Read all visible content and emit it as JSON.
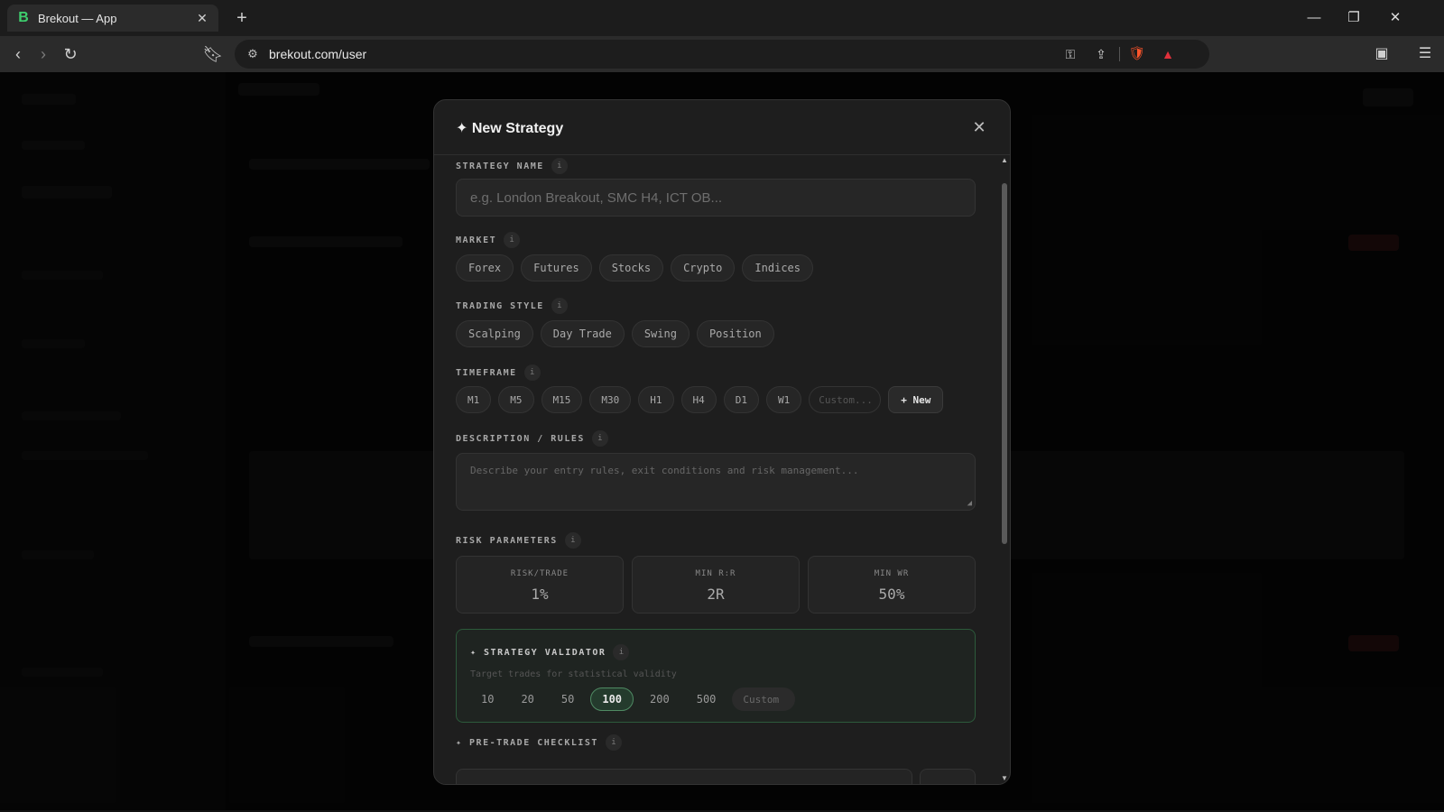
{
  "browser": {
    "tab_title": "Brekout — App",
    "tab_favicon": "B",
    "url": "brekout.com/user"
  },
  "modal": {
    "title": "✦ New Strategy",
    "strategy_name": {
      "label": "STRATEGY NAME",
      "placeholder": "e.g. London Breakout, SMC H4, ICT OB..."
    },
    "market": {
      "label": "MARKET",
      "options": [
        "Forex",
        "Futures",
        "Stocks",
        "Crypto",
        "Indices"
      ]
    },
    "trading_style": {
      "label": "TRADING STYLE",
      "options": [
        "Scalping",
        "Day Trade",
        "Swing",
        "Position"
      ]
    },
    "timeframe": {
      "label": "TIMEFRAME",
      "options": [
        "M1",
        "M5",
        "M15",
        "M30",
        "H1",
        "H4",
        "D1",
        "W1"
      ],
      "custom_placeholder": "Custom...",
      "new_label": "+ New"
    },
    "description": {
      "label": "DESCRIPTION / RULES",
      "placeholder": "Describe your entry rules, exit conditions and risk management..."
    },
    "risk": {
      "label": "RISK PARAMETERS",
      "boxes": [
        {
          "label": "RISK/TRADE",
          "value": "1%"
        },
        {
          "label": "MIN R:R",
          "value": "2R"
        },
        {
          "label": "MIN WR",
          "value": "50%"
        }
      ]
    },
    "validator": {
      "title": "✦ STRATEGY VALIDATOR",
      "subtitle": "Target trades for statistical validity",
      "options": [
        "10",
        "20",
        "50",
        "100",
        "200",
        "500"
      ],
      "selected": "100",
      "custom_placeholder": "Custom"
    },
    "checklist": {
      "label": "✦ PRE-TRADE CHECKLIST"
    }
  },
  "colors": {
    "accent_green": "#3ecf6e",
    "validator_border": "#2c5a3b"
  }
}
